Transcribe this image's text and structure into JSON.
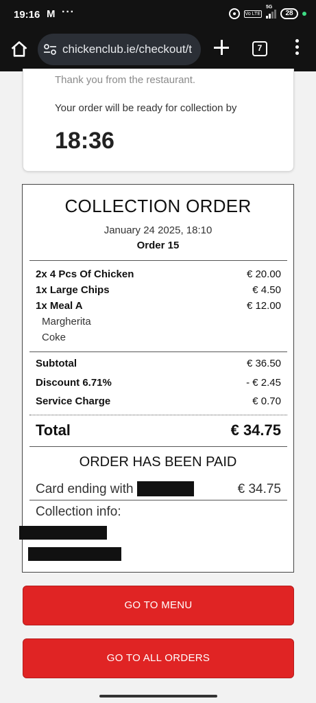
{
  "status_bar": {
    "time": "19:16",
    "mail_icon": "M",
    "more": "···",
    "network": "5G",
    "volte": "Vo LTE",
    "battery": "28"
  },
  "browser": {
    "url": "chickenclub.ie/checkout/t",
    "tab_count": "7"
  },
  "ready_card": {
    "thanks": "Thank you from the restaurant.",
    "ready_by": "Your order will be ready for collection by",
    "time": "18:36"
  },
  "receipt": {
    "title": "COLLECTION ORDER",
    "date": "January 24 2025, 18:10",
    "order": "Order 15",
    "items": [
      {
        "label": "2x 4 Pcs Of Chicken",
        "price": "€ 20.00"
      },
      {
        "label": "1x Large Chips",
        "price": "€ 4.50"
      },
      {
        "label": "1x Meal A",
        "price": "€ 12.00"
      }
    ],
    "sub_items": [
      "Margherita",
      "Coke"
    ],
    "subtotal": {
      "label": "Subtotal",
      "value": "€ 36.50"
    },
    "discount": {
      "label": "Discount 6.71%",
      "value": "- € 2.45"
    },
    "service": {
      "label": "Service Charge",
      "value": "€ 0.70"
    },
    "total": {
      "label": "Total",
      "value": "€ 34.75"
    },
    "paid": "ORDER HAS BEEN PAID",
    "card": {
      "label": "Card ending with",
      "value": "€ 34.75"
    },
    "collection_info": "Collection info:"
  },
  "buttons": {
    "menu": "GO TO MENU",
    "orders": "GO TO ALL ORDERS"
  },
  "colors": {
    "accent": "#e02424",
    "topbar": "#121212"
  }
}
